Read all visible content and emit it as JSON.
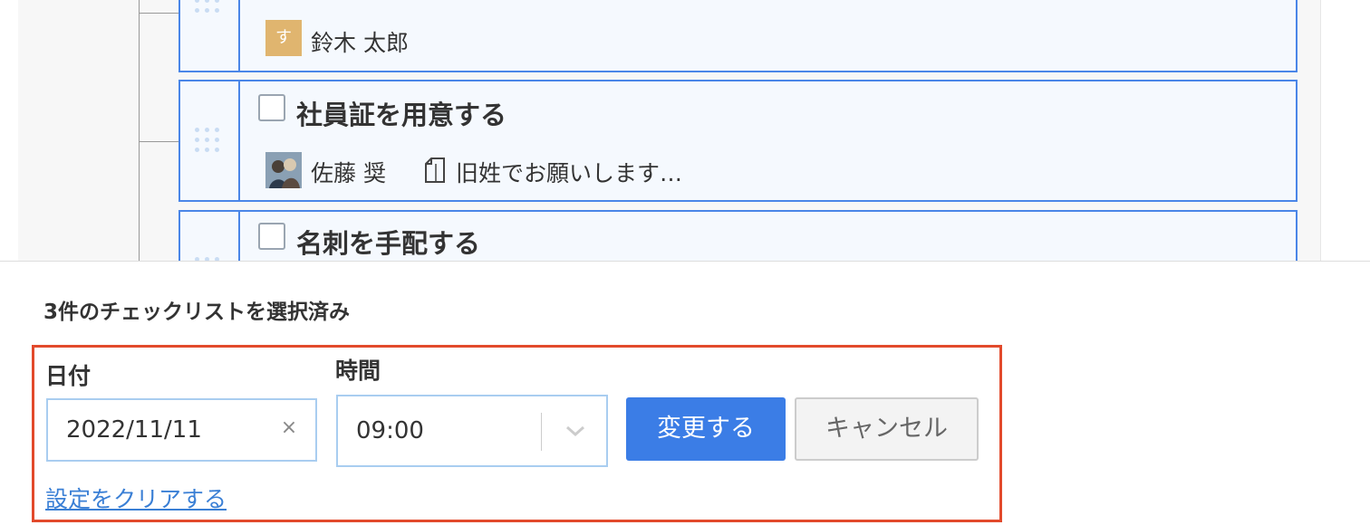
{
  "tasks": [
    {
      "assignee": {
        "avatar_letter": "す",
        "name": "鈴木 太郎",
        "avatar_color": "#e0b56f"
      }
    },
    {
      "title": "社員証を用意する",
      "assignee": {
        "name": "佐藤 奨",
        "avatar": "photo-avatar"
      },
      "memo": {
        "icon": "memo-icon",
        "text": "旧姓でお願いします…"
      }
    },
    {
      "title": "名刺を手配する"
    }
  ],
  "bulk_edit": {
    "selected_count_text": "3件のチェックリストを選択済み",
    "date_label": "日付",
    "date_value": "2022/11/11",
    "date_clear_symbol": "×",
    "time_label": "時間",
    "time_value": "09:00",
    "apply_button": "変更する",
    "cancel_button": "キャンセル",
    "clear_link": "設定をクリアする"
  },
  "colors": {
    "accent": "#3b7de6",
    "card_border": "#4a86e8",
    "highlight_border": "#e24a2c",
    "link": "#3a7fd5"
  }
}
